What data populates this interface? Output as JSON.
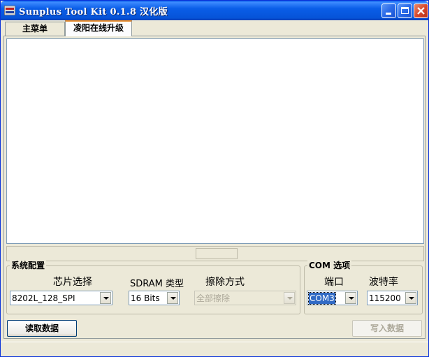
{
  "window": {
    "title": "Sunplus Tool Kit 0.1.8 汉化版"
  },
  "tabs": [
    {
      "label": "主菜单",
      "active": false
    },
    {
      "label": "凌阳在线升级",
      "active": true
    }
  ],
  "system_config": {
    "group_label": "系统配置",
    "chip_select": {
      "label": "芯片选择",
      "value": "8202L_128_SPI"
    },
    "sdram_type": {
      "label": "SDRAM 类型",
      "value": "16 Bits"
    },
    "erase_mode": {
      "label": "擦除方式",
      "value": "全部擦除",
      "disabled": true
    }
  },
  "com_options": {
    "group_label": "COM 选项",
    "port": {
      "label": "端口",
      "value": "COM3"
    },
    "baud_rate": {
      "label": "波特率",
      "value": "115200"
    }
  },
  "buttons": {
    "read_data": "读取数据",
    "write_data": "写入数据"
  },
  "colors": {
    "titlebar": "#0a5ee8",
    "selection": "#316ac5",
    "tab_accent": "#e68b2c"
  }
}
